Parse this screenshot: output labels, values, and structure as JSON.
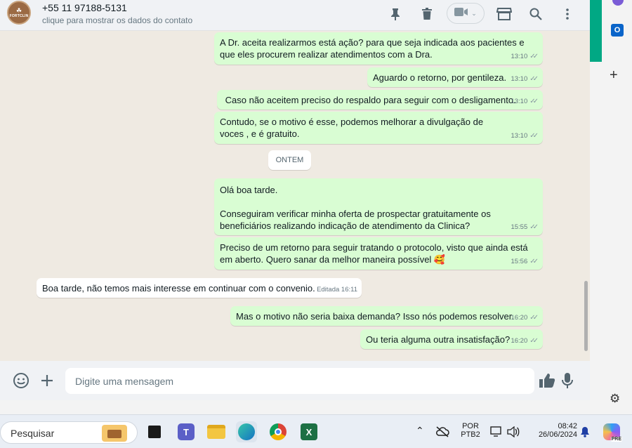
{
  "contact": {
    "phone": "+55 11 97188-5131",
    "subtitle": "clique para mostrar os dados do contato",
    "avatar_text": "FORTCLIN"
  },
  "messages": [
    {
      "direction": "out",
      "text": "A Dr. aceita realizarmos está ação? para que seja indicada aos pacientes e que eles procurem realizar atendimentos com a Dra.",
      "time": "13:10"
    },
    {
      "direction": "out",
      "text": "Aguardo o retorno, por gentileza.",
      "time": "13:10"
    },
    {
      "direction": "out",
      "text": " Caso não aceitem preciso do respaldo para seguir com o desligamento.",
      "time": "13:10"
    },
    {
      "direction": "out",
      "text": "Contudo, se o motivo é esse, podemos melhorar a divulgação de voces , e é gratuito.",
      "time": "13:10"
    },
    {
      "direction": "out",
      "text": "Olá boa tarde.\n\nConseguiram verificar minha oferta de prospectar gratuitamente os beneficiários realizando indicação de atendimento da Clinica?",
      "time": "15:55"
    },
    {
      "direction": "out",
      "text": "Preciso de um retorno para seguir tratando o protocolo, visto que ainda está em aberto. Quero sanar da melhor maneira possível 🥰",
      "time": "15:56"
    },
    {
      "direction": "in",
      "text": "Boa tarde, não temos mais interesse em continuar com o convenio.",
      "time": "Editada 16:11"
    },
    {
      "direction": "out",
      "text": "Mas o motivo não seria baixa demanda? Isso nós podemos resolver.",
      "time": "16:20"
    },
    {
      "direction": "out",
      "text": "Ou teria alguma outra insatisfação?",
      "time": "16:20"
    }
  ],
  "day_divider": "ONTEM",
  "composer": {
    "placeholder": "Digite uma mensagem"
  },
  "taskbar": {
    "search_label": "Pesquisar",
    "lang_top": "POR",
    "lang_bottom": "PTB2",
    "time": "08:42",
    "date": "26/06/2024",
    "copilot_badge": "PRE"
  },
  "colors": {
    "outgoing_bubble": "#d9fdd3",
    "incoming_bubble": "#ffffff",
    "chat_bg": "#efeae2",
    "accent": "#01a884"
  }
}
